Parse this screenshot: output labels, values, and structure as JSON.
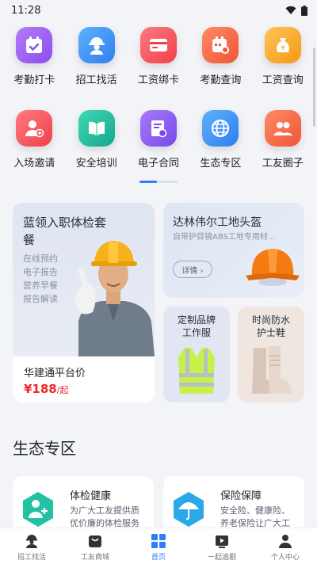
{
  "status": {
    "time": "11:28"
  },
  "grid_row1": [
    {
      "label": "考勤打卡",
      "icon": "calendar-check-icon",
      "color": "#9a5ef2"
    },
    {
      "label": "招工找活",
      "icon": "worker-icon",
      "color": "#3a8ef6"
    },
    {
      "label": "工资绑卡",
      "icon": "bank-card-icon",
      "color": "#f2545b"
    },
    {
      "label": "考勤查询",
      "icon": "calendar-search-icon",
      "color": "#f26b4f"
    },
    {
      "label": "工资查询",
      "icon": "money-bag-icon",
      "color": "#f6a623"
    }
  ],
  "grid_row2": [
    {
      "label": "入场邀请",
      "icon": "user-add-icon",
      "color": "#f2545b"
    },
    {
      "label": "安全培训",
      "icon": "book-icon",
      "color": "#22c1a1"
    },
    {
      "label": "电子合同",
      "icon": "contract-icon",
      "color": "#8b5cf6"
    },
    {
      "label": "生态专区",
      "icon": "globe-icon",
      "color": "#3a8ef6"
    },
    {
      "label": "工友圈子",
      "icon": "group-icon",
      "color": "#f26b4f"
    }
  ],
  "page_indicator": {
    "position": 0.45
  },
  "promo": {
    "exam": {
      "title": "蓝领入职体检套餐",
      "features": [
        "在线预约",
        "电子报告",
        "营养早餐",
        "报告解读"
      ],
      "price_label": "华建通平台价",
      "price": "¥188",
      "price_unit": "/起"
    },
    "helmet": {
      "title": "达林伟尔工地头盔",
      "subtitle": "自带护目镜ABS工地专用材...",
      "button": "详情 ›"
    },
    "vest": {
      "title_l1": "定制品牌",
      "title_l2": "工作服"
    },
    "boot": {
      "title_l1": "时尚防水",
      "title_l2": "护士鞋"
    }
  },
  "eco_section": {
    "title": "生态专区",
    "cards": [
      {
        "title": "体检健康",
        "desc": "为广大工友提供质优价廉的体检服务体验",
        "icon": "health-icon",
        "color": "#22c1a1"
      },
      {
        "title": "保险保障",
        "desc": "安全险、健康险、养老保险让广大工友...",
        "icon": "umbrella-icon",
        "color": "#2aa8e8"
      }
    ]
  },
  "tabbar": [
    {
      "label": "招工找活",
      "icon": "worker-tab-icon"
    },
    {
      "label": "工友商城",
      "icon": "shop-tab-icon"
    },
    {
      "label": "首页",
      "icon": "home-tab-icon",
      "active": true
    },
    {
      "label": "一起追剧",
      "icon": "video-tab-icon"
    },
    {
      "label": "个人中心",
      "icon": "profile-tab-icon"
    }
  ]
}
